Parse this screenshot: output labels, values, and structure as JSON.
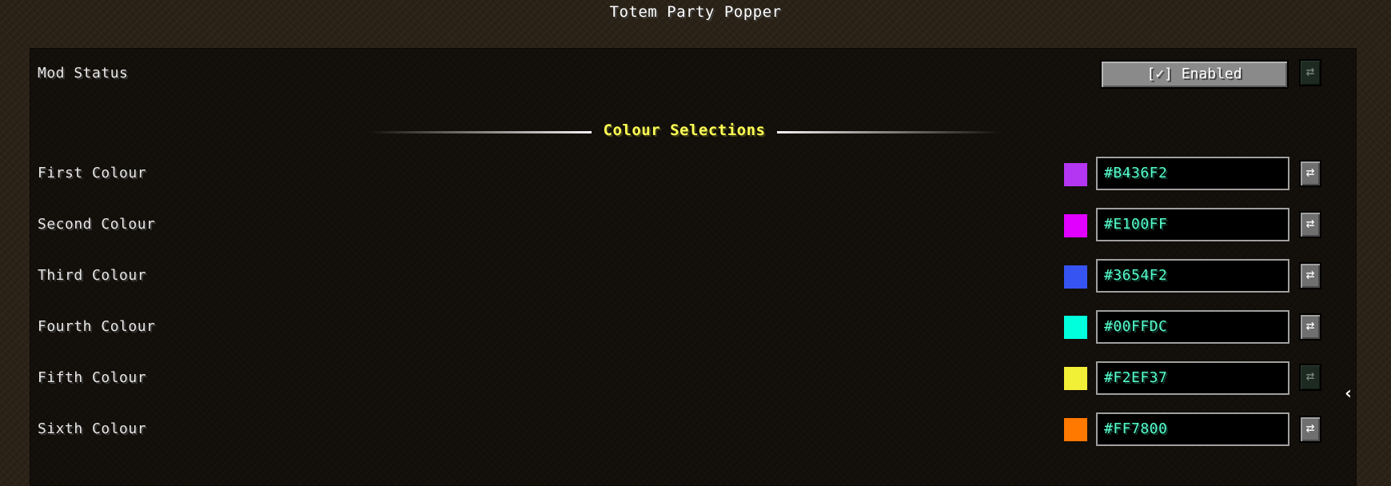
{
  "window": {
    "title": "Totem Party Popper"
  },
  "mod_status": {
    "label": "Mod Status",
    "button_label": "[✓] Enabled",
    "reset_icon": "⇄"
  },
  "colour_section": {
    "title": "Colour Selections"
  },
  "colours": [
    {
      "label": "First Colour",
      "hex": "#B436F2",
      "swatch": "#B436F2",
      "reset_icon": "⇄"
    },
    {
      "label": "Second Colour",
      "hex": "#E100FF",
      "swatch": "#E100FF",
      "reset_icon": "⇄"
    },
    {
      "label": "Third Colour",
      "hex": "#3654F2",
      "swatch": "#3654F2",
      "reset_icon": "⇄"
    },
    {
      "label": "Fourth Colour",
      "hex": "#00FFDC",
      "swatch": "#00FFDC",
      "reset_icon": "⇄"
    },
    {
      "label": "Fifth Colour",
      "hex": "#F2EF37",
      "swatch": "#F2EF37",
      "reset_icon": "⇄"
    },
    {
      "label": "Sixth Colour",
      "hex": "#FF7800",
      "swatch": "#FF7800",
      "reset_icon": "⇄"
    }
  ],
  "icons": {
    "reset": "swap-arrows-icon",
    "collapse": "chevron-left-icon",
    "collapse_glyph": "‹"
  }
}
